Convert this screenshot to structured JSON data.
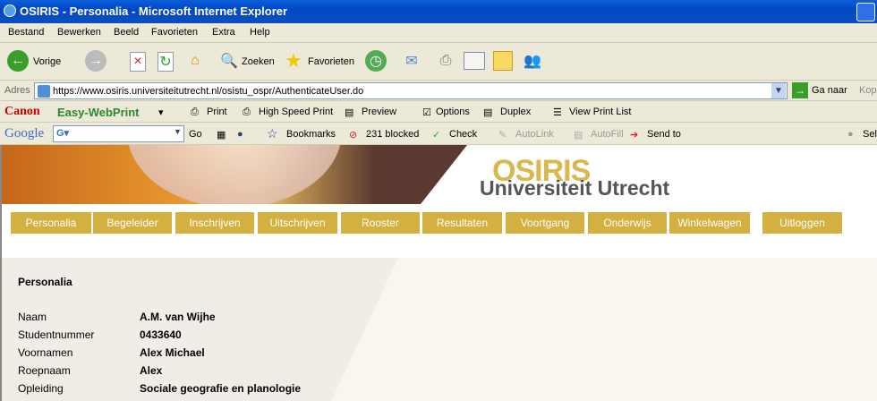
{
  "window": {
    "title": "OSIRIS - Personalia - Microsoft Internet Explorer"
  },
  "menu": [
    "Bestand",
    "Bewerken",
    "Beeld",
    "Favorieten",
    "Extra",
    "Help"
  ],
  "toolbar": {
    "back": "Vorige",
    "search": "Zoeken",
    "favorites": "Favorieten"
  },
  "address": {
    "label": "Adres",
    "url": "https://www.osiris.universiteitutrecht.nl/osistu_ospr/AuthenticateUser.do",
    "go": "Ga naar",
    "links": "Kop"
  },
  "canon": {
    "brand": "Canon",
    "product": "Easy-WebPrint",
    "print": "Print",
    "hsp": "High Speed Print",
    "preview": "Preview",
    "options": "Options",
    "duplex": "Duplex",
    "list": "View Print List"
  },
  "google": {
    "brand": "Google",
    "go": "Go",
    "bookmarks": "Bookmarks",
    "blocked": "231 blocked",
    "check": "Check",
    "autolink": "AutoLink",
    "autofill": "AutoFill",
    "sendto": "Send to",
    "settings": "Sel"
  },
  "site": {
    "name": "OSIRIS",
    "university": "Universiteit Utrecht",
    "accent": "#d4b040"
  },
  "nav": [
    "Personalia",
    "Begeleider",
    "Inschrijven",
    "Uitschrijven",
    "Rooster",
    "Resultaten",
    "Voortgang",
    "Onderwijs",
    "Winkelwagen",
    "Uitloggen"
  ],
  "personalia": {
    "heading": "Personalia",
    "rows": [
      {
        "label": "Naam",
        "value": "A.M. van Wijhe"
      },
      {
        "label": "Studentnummer",
        "value": "0433640"
      },
      {
        "label": "Voornamen",
        "value": "Alex Michael"
      },
      {
        "label": "Roepnaam",
        "value": "Alex"
      },
      {
        "label": "Opleiding",
        "value": "Sociale geografie en planologie"
      }
    ]
  }
}
